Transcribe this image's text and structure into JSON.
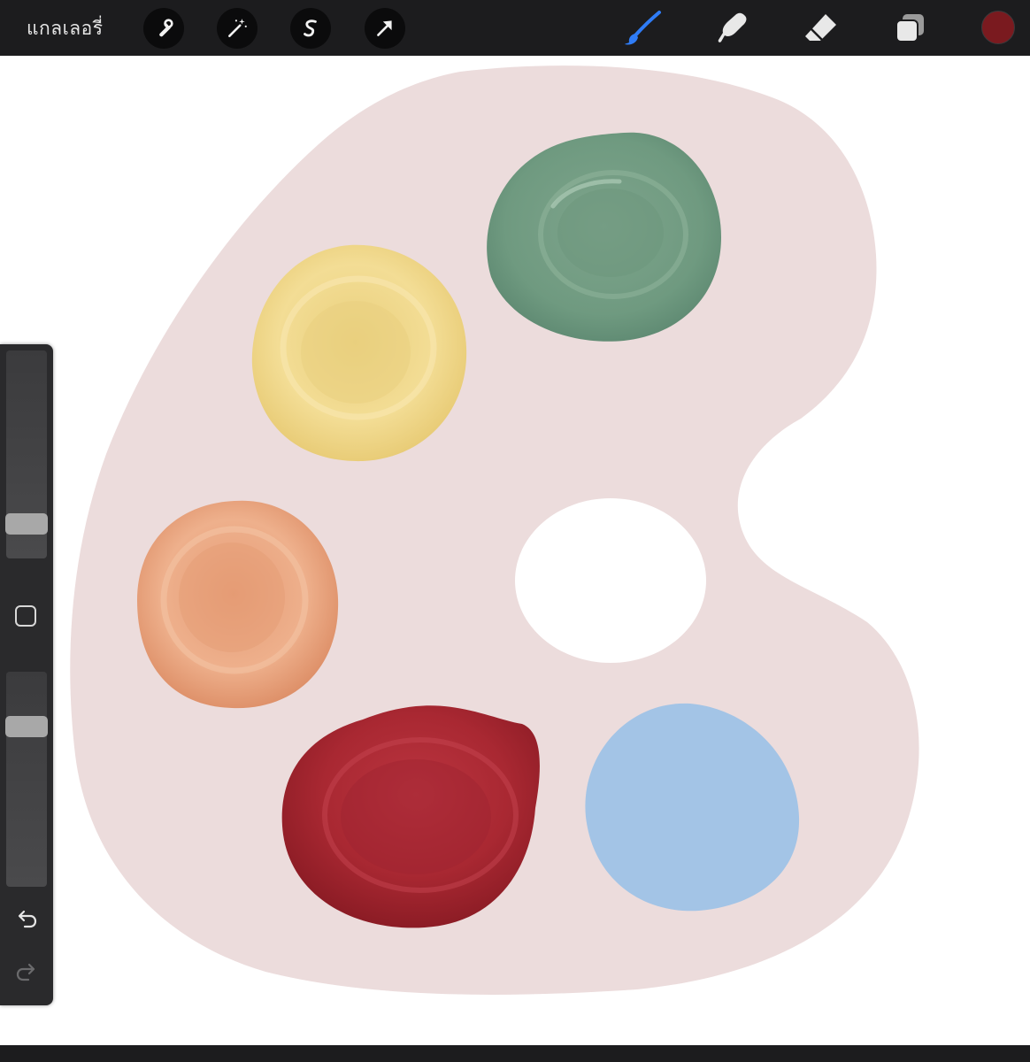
{
  "toolbar": {
    "gallery_label": "แกลเลอรี่",
    "left_tools": [
      "wrench-icon",
      "magic-wand-icon",
      "selection-icon",
      "transform-arrow-icon"
    ],
    "right_tools": [
      "brush-icon",
      "smudge-icon",
      "eraser-icon",
      "layers-icon"
    ],
    "active_tool": "brush-icon",
    "current_color": "#7a1a1f",
    "active_tool_color": "#2f7cf6"
  },
  "sidebar": {
    "brush_size_level": 0.13,
    "opacity_level": 0.77,
    "icons": [
      "modify-square-icon",
      "undo-icon",
      "redo-icon"
    ]
  },
  "artwork": {
    "palette_color": "#ecdcdc",
    "paint_colors": {
      "green": "#6f9a80",
      "yellow": "#efd98c",
      "orange": "#e8a47c",
      "red": "#ab2a33",
      "blue": "#a3c4e6"
    }
  }
}
